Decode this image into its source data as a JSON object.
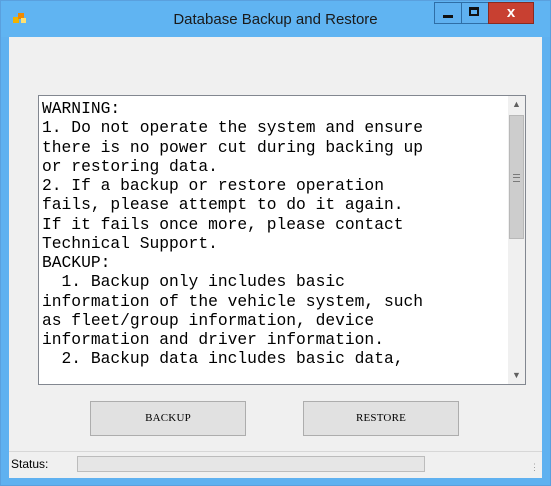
{
  "window": {
    "title": "Database Backup and Restore",
    "icon": "app-icon",
    "controls": {
      "minimize": "minimize-icon",
      "maximize": "maximize-icon",
      "close": "x"
    }
  },
  "notes": {
    "text": "WARNING:\n1. Do not operate the system and ensure\nthere is no power cut during backing up\nor restoring data.\n2. If a backup or restore operation\nfails, please attempt to do it again.\nIf it fails once more, please contact\nTechnical Support.\nBACKUP:\n  1. Backup only includes basic\ninformation of the vehicle system, such\nas fleet/group information, device\ninformation and driver information.\n  2. Backup data includes basic data,"
  },
  "buttons": {
    "backup_label": "BACKUP",
    "restore_label": "RESTORE"
  },
  "status": {
    "label": "Status:",
    "progress_fraction": 0
  },
  "colors": {
    "title_bar": "#60b4f2",
    "close_button": "#c84031",
    "client_background": "#f0f0f0"
  }
}
